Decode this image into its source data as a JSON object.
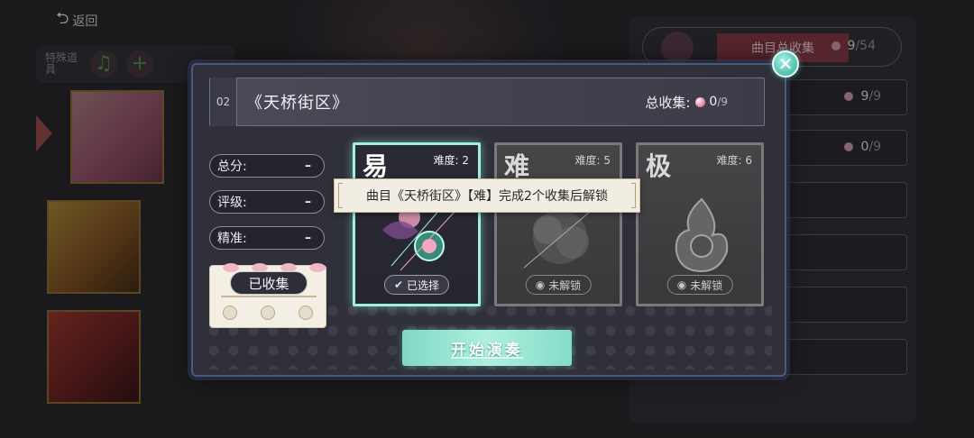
{
  "nav": {
    "back_label": "返回"
  },
  "left_tabs": {
    "label": "特殊道具"
  },
  "right_panel": {
    "header_label": "曲目总收集",
    "header_count": "9",
    "header_total": "/54",
    "rows": [
      {
        "count": "9",
        "total": "/9"
      },
      {
        "count": "0",
        "total": "/9"
      }
    ]
  },
  "modal": {
    "song_number": "02",
    "song_title": "《天桥街区》",
    "total_collect_label": "总收集:",
    "total_collect_count": "0",
    "total_collect_total": "/9",
    "stats": {
      "total_score_label": "总分:",
      "total_score_value": "–",
      "rating_label": "评级:",
      "rating_value": "–",
      "accuracy_label": "精准:",
      "accuracy_value": "–"
    },
    "collected_label": "已收集",
    "difficulties": [
      {
        "char": "易",
        "level_label": "难度: 2",
        "status": "已选择",
        "state": "selected"
      },
      {
        "char": "难",
        "level_label": "难度: 5",
        "status": "未解锁",
        "state": "locked"
      },
      {
        "char": "极",
        "level_label": "难度: 6",
        "status": "未解锁",
        "state": "locked"
      }
    ],
    "tooltip": "曲目《天桥街区》【难】完成2个收集后解锁",
    "start_label": "开始演奏"
  },
  "colors": {
    "accent_teal": "#9ff0e0",
    "gem_pink": "#f3a6c0",
    "header_badge": "#8a3a48"
  }
}
